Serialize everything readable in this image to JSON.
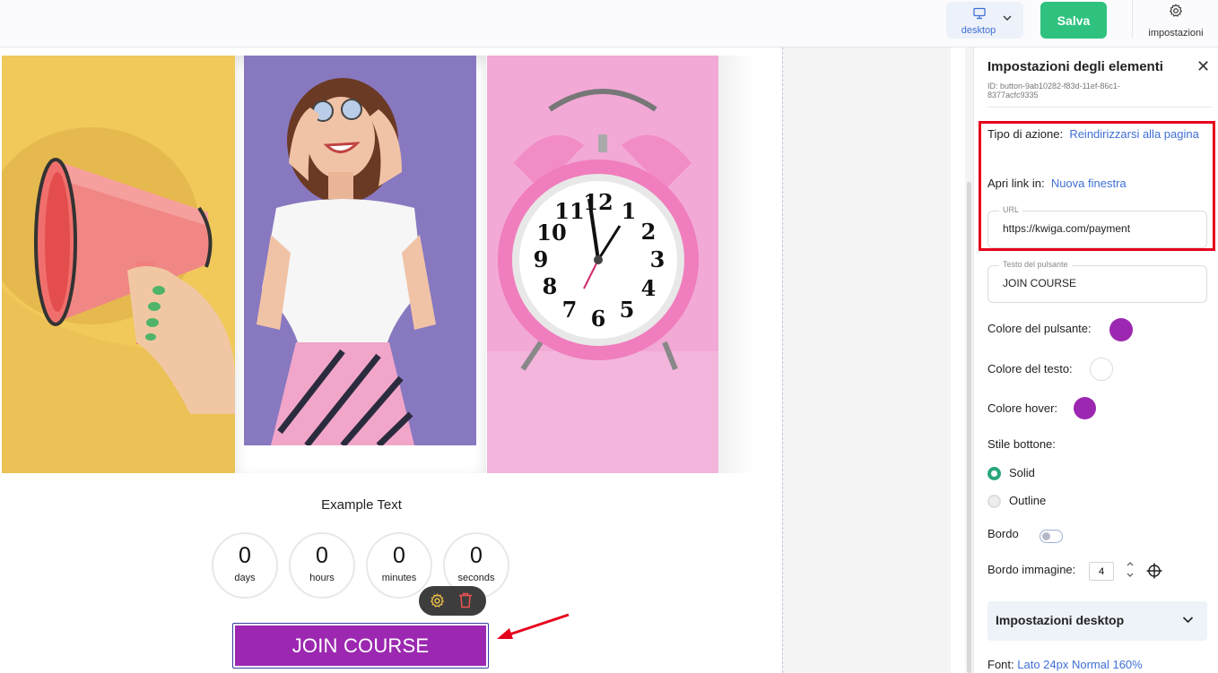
{
  "topbar": {
    "device_label": "desktop",
    "save_label": "Salva",
    "settings_label": "impostazioni"
  },
  "canvas": {
    "example_text": "Example Text",
    "countdown": [
      {
        "value": "0",
        "unit": "days"
      },
      {
        "value": "0",
        "unit": "hours"
      },
      {
        "value": "0",
        "unit": "minutes"
      },
      {
        "value": "0",
        "unit": "seconds"
      }
    ],
    "join_button_label": "JOIN COURSE"
  },
  "panel": {
    "title": "Impostazioni degli elementi",
    "id_text": "ID: button-9ab10282-f83d-11ef-86c1-8377acfc9335",
    "action_type_label": "Tipo di azione:",
    "action_type_value": "Reindirizzarsi alla pagina",
    "open_link_label": "Apri link in:",
    "open_link_value": "Nuova finestra",
    "url_label": "URL",
    "url_value": "https://kwiga.com/payment",
    "button_text_label": "Testo del pulsante",
    "button_text_value": "JOIN COURSE",
    "button_color_label": "Colore del pulsante:",
    "text_color_label": "Colore del testo:",
    "hover_color_label": "Colore hover:",
    "button_style_label": "Stile bottone:",
    "style_solid": "Solid",
    "style_outline": "Outline",
    "border_label": "Bordo",
    "image_border_label": "Bordo immagine:",
    "image_border_value": "4",
    "desktop_settings_label": "Impostazioni desktop",
    "font_label": "Font:",
    "font_value": "Lato 24px Normal 160%"
  },
  "colors": {
    "button_color": "#9c27b0",
    "text_color": "#ffffff",
    "hover_color": "#9c27b0",
    "save_green": "#2ec27e",
    "accent_blue": "#3f6fd6",
    "highlight_red": "#e5001c"
  },
  "icons": [
    "monitor-icon",
    "chevron-down-icon",
    "gear-icon",
    "close-icon",
    "trash-icon",
    "crosshair-icon",
    "arrow-annotation-icon"
  ]
}
